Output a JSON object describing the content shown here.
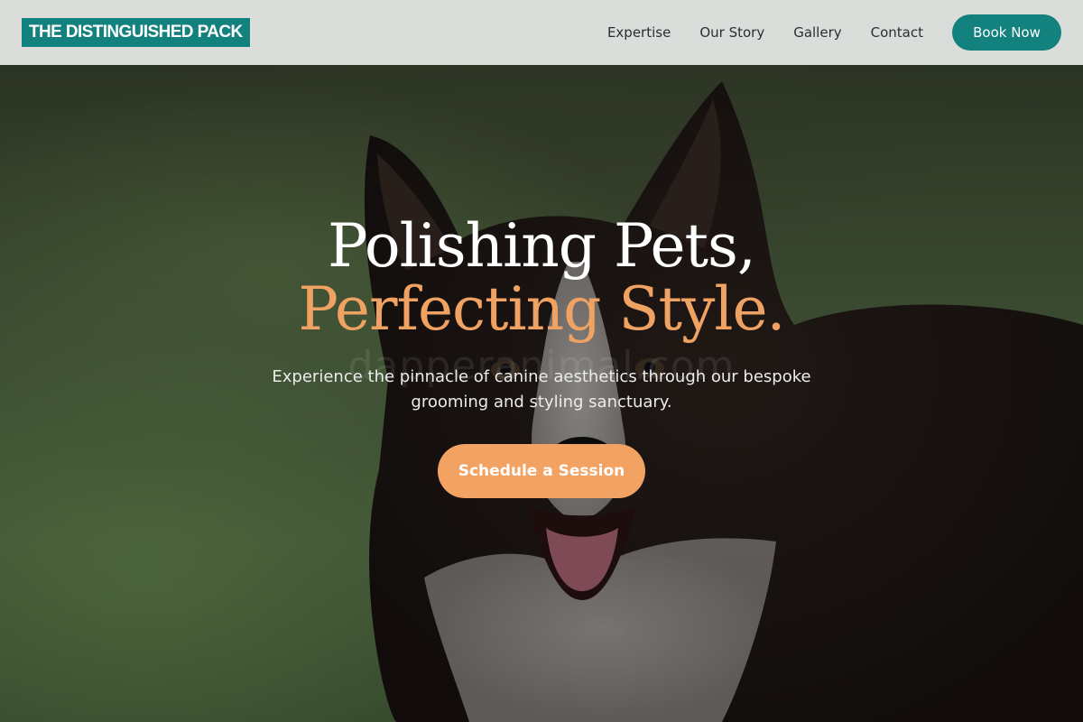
{
  "site": {
    "logo_text": "THE DISTINGUISHED PACK",
    "brand_color": "#13817e",
    "accent_color": "#f2a364"
  },
  "nav": {
    "items": [
      {
        "label": "Expertise"
      },
      {
        "label": "Our Story"
      },
      {
        "label": "Gallery"
      },
      {
        "label": "Contact"
      }
    ],
    "cta_label": "Book Now"
  },
  "hero": {
    "headline_line1": "Polishing Pets,",
    "headline_line2": "Perfecting Style.",
    "watermark": "dapperanimal.com",
    "subtext": "Experience the pinnacle of canine aesthetics through our bespoke grooming and styling sanctuary.",
    "cta_label": "Schedule a Session",
    "background_image": "dog-photo"
  }
}
